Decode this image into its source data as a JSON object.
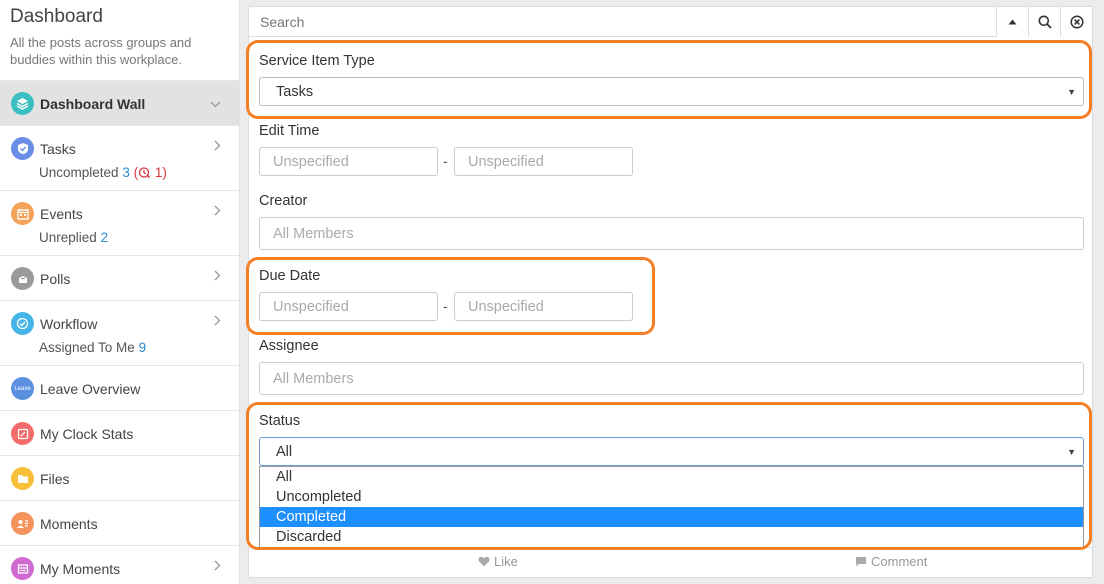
{
  "sidebar": {
    "title": "Dashboard",
    "description": "All the posts across groups and buddies within this workplace.",
    "items": [
      {
        "label": "Dashboard Wall",
        "icon": "layers-icon",
        "color": "#3bbfc1"
      },
      {
        "label": "Tasks",
        "icon": "shield-check-icon",
        "color": "#6a8de6",
        "sub_label": "Uncompleted",
        "sub_count": "3",
        "alert_count": "1"
      },
      {
        "label": "Events",
        "icon": "calendar-icon",
        "color": "#f4a259",
        "sub_label": "Unreplied",
        "sub_count": "2"
      },
      {
        "label": "Polls",
        "icon": "ballot-icon",
        "color": "#9a9a9a"
      },
      {
        "label": "Workflow",
        "icon": "check-circle-icon",
        "color": "#45b5e8",
        "sub_label": "Assigned To Me",
        "sub_count": "9"
      },
      {
        "label": "Leave Overview",
        "icon": "leave-icon",
        "icon_text": "Leave",
        "color": "#5b8fe0"
      },
      {
        "label": "My Clock Stats",
        "icon": "clock-stats-icon",
        "color": "#f36b6b"
      },
      {
        "label": "Files",
        "icon": "folder-icon",
        "color": "#f7bf3a"
      },
      {
        "label": "Moments",
        "icon": "people-icon",
        "color": "#f4945c"
      },
      {
        "label": "My Moments",
        "icon": "card-icon",
        "color": "#d06ad0"
      }
    ]
  },
  "search": {
    "placeholder": "Search"
  },
  "filters": {
    "service_item_type": {
      "label": "Service Item Type",
      "value": "Tasks"
    },
    "edit_time": {
      "label": "Edit Time",
      "from_placeholder": "Unspecified",
      "to_placeholder": "Unspecified",
      "separator": "-"
    },
    "creator": {
      "label": "Creator",
      "placeholder": "All Members"
    },
    "due_date": {
      "label": "Due Date",
      "from_placeholder": "Unspecified",
      "to_placeholder": "Unspecified",
      "separator": "-"
    },
    "assignee": {
      "label": "Assignee",
      "placeholder": "All Members"
    },
    "status": {
      "label": "Status",
      "value": "All",
      "options": [
        "All",
        "Uncompleted",
        "Completed",
        "Discarded"
      ],
      "highlighted": "Completed"
    }
  },
  "footer": {
    "like_label": "Like",
    "comment_label": "Comment"
  },
  "colors": {
    "highlight": "#f47f24",
    "selected_option": "#1e8fff",
    "link": "#2a8bd0",
    "alert": "#d9363e"
  }
}
